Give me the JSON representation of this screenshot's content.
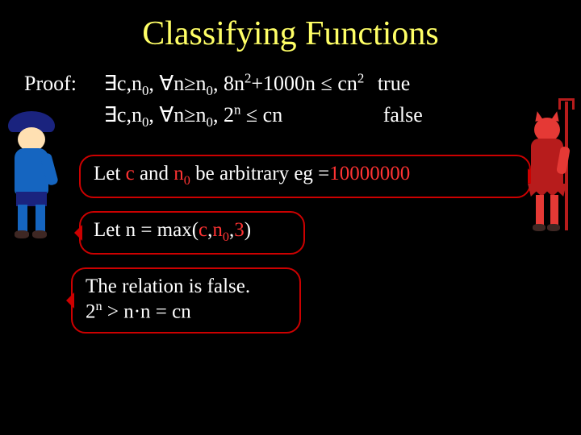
{
  "title": "Classifying Functions",
  "proof": {
    "label": "Proof:",
    "line1": {
      "prefix": "∃c,n",
      "sub1": "0",
      "mid1": ", ∀n≥n",
      "sub2": "0",
      "mid2": ", 8n",
      "sup1": "2",
      "mid3": "+1000n ≤ cn",
      "sup2": "2",
      "verdict": "true"
    },
    "line2": {
      "prefix": "∃c,n",
      "sub1": "0",
      "mid1": ", ∀n≥n",
      "sub2": "0",
      "mid2": ", 2",
      "sup1": "n",
      "mid3": " ≤ cn",
      "verdict": "false"
    }
  },
  "bubbles": {
    "b1": {
      "p1": "Let ",
      "c": "c",
      "p2": " and ",
      "n0a": "n",
      "n0s": "0",
      "p3": " be arbitrary eg =",
      "num": "10000000"
    },
    "b2": {
      "p1": "Let n = max(",
      "c": "c",
      "p2": ",",
      "n0a": "n",
      "n0s": "0",
      "p3": ",",
      "three": "3",
      "p4": ")"
    },
    "b3": {
      "line1": "The relation is false.",
      "l2a": " 2",
      "l2sup": "n",
      "l2b": " > n·n = cn"
    }
  }
}
